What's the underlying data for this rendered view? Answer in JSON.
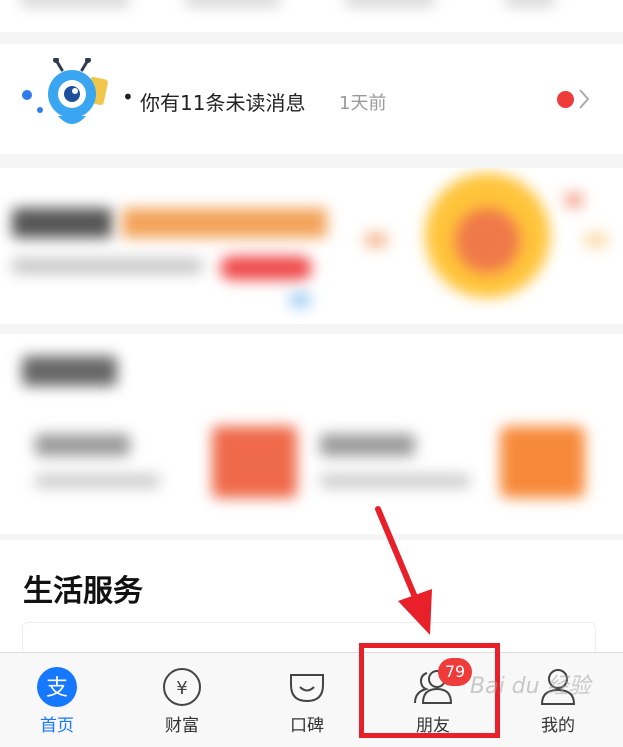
{
  "message": {
    "bullet": "•",
    "text": "你有11条未读消息",
    "time": "1天前"
  },
  "life": {
    "title": "生活服务"
  },
  "tabbar": {
    "tabs": [
      {
        "id": "home",
        "label": "首页",
        "icon": "alipay-friend-icon",
        "active": true
      },
      {
        "id": "wealth",
        "label": "财富",
        "icon": "yen-circle-icon",
        "active": false
      },
      {
        "id": "koubei",
        "label": "口碑",
        "icon": "koubei-bag-icon",
        "active": false
      },
      {
        "id": "friends",
        "label": "朋友",
        "icon": "friends-icon",
        "active": false,
        "badge": "79"
      },
      {
        "id": "mine",
        "label": "我的",
        "icon": "person-icon",
        "active": false
      }
    ]
  },
  "watermark": "Bai du 经验",
  "colors": {
    "accent": "#1677ff",
    "badge": "#f03b3b",
    "highlight": "#e8202a"
  }
}
